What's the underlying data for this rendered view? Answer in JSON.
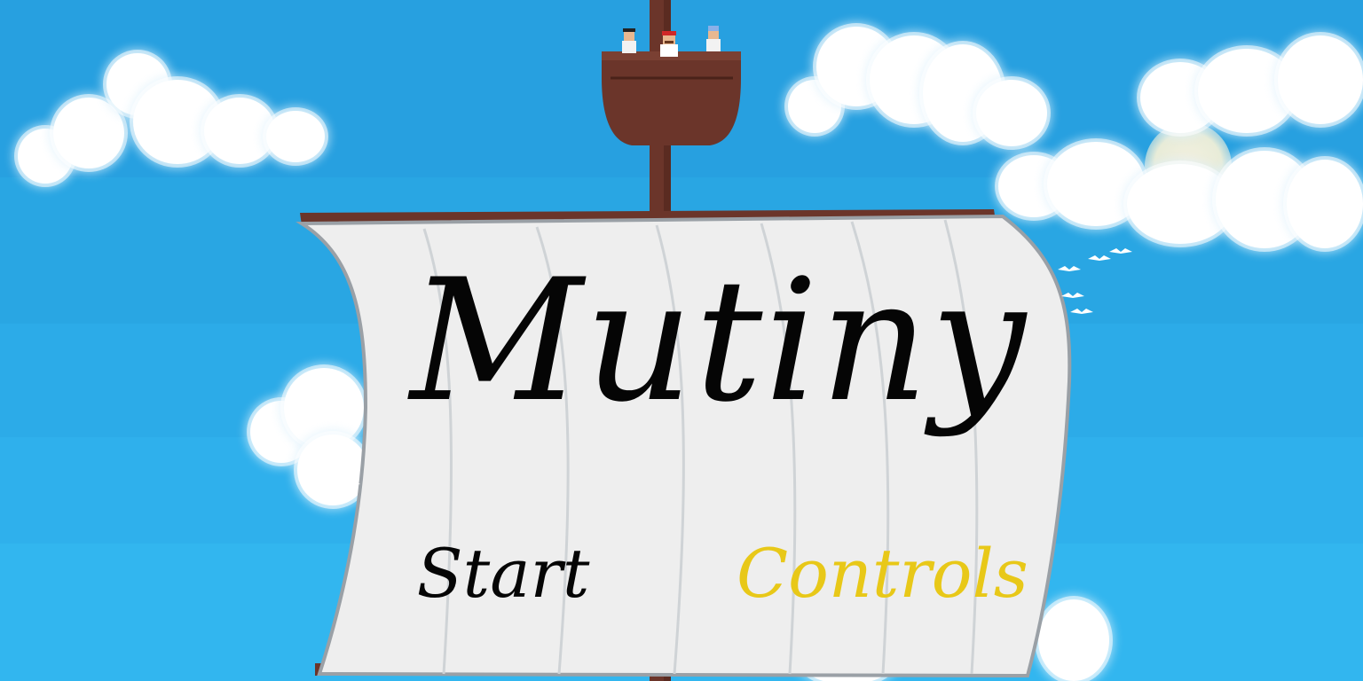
{
  "game": {
    "title": "Mutiny"
  },
  "menu": {
    "start_label": "Start",
    "controls_label": "Controls",
    "selected": "Controls"
  },
  "colors": {
    "sky_top": "#2aa0de",
    "sky_bottom": "#31b3ee",
    "sail": "#eeeeee",
    "sail_edge": "#9aa0a6",
    "wood": "#6b352a",
    "wood_dark": "#4a2219",
    "text_default": "#050505",
    "text_selected": "#e8c818"
  },
  "icons": {
    "crow_nest": "crows-nest-icon",
    "crew": [
      "crew-member-icon",
      "crew-member-icon",
      "crew-member-icon"
    ],
    "seagull": "seagull-icon"
  }
}
